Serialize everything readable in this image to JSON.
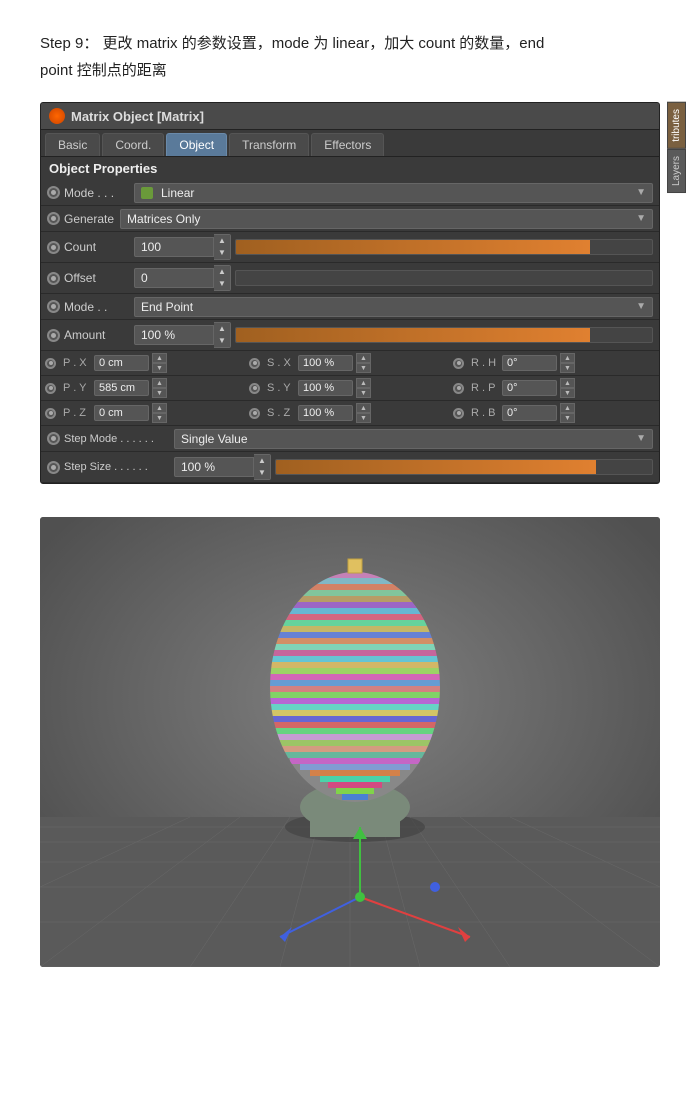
{
  "page": {
    "step_text_line1": "Step 9： 更改 matrix 的参数设置，mode 为 linear，加大 count 的数量，end",
    "step_text_line2": "point  控制点的距离"
  },
  "panel": {
    "title": "Matrix Object [Matrix]",
    "tabs": [
      "Basic",
      "Coord.",
      "Object",
      "Transform",
      "Effectors"
    ],
    "active_tab": "Object",
    "side_tabs": [
      "tributes",
      "Layers"
    ],
    "section_header": "Object Properties",
    "mode_label": "Mode . . .",
    "mode_icon": "linear-icon",
    "mode_value": "Linear",
    "generate_label": "Generate",
    "generate_value": "Matrices Only",
    "count_label": "Count",
    "count_value": "100",
    "count_progress": 85,
    "offset_label": "Offset",
    "offset_value": "0",
    "mode2_label": "Mode . .",
    "mode2_value": "End Point",
    "amount_label": "Amount",
    "amount_value": "100 %",
    "amount_progress": 85,
    "px_label": "P . X",
    "px_value": "0 cm",
    "sx_label": "S . X",
    "sx_value": "100 %",
    "rh_label": "R . H",
    "rh_value": "0°",
    "py_label": "P . Y",
    "py_value": "585 cm",
    "sy_label": "S . Y",
    "sy_value": "100 %",
    "rp_label": "R . P",
    "rp_value": "0°",
    "pz_label": "P . Z",
    "pz_value": "0 cm",
    "sz_label": "S . Z",
    "sz_value": "100 %",
    "rb_label": "R . B",
    "rb_value": "0°",
    "step_mode_label": "Step Mode . . . . . .",
    "step_mode_value": "Single Value",
    "step_size_label": "Step Size . . . . . .",
    "step_size_value": "100 %"
  }
}
